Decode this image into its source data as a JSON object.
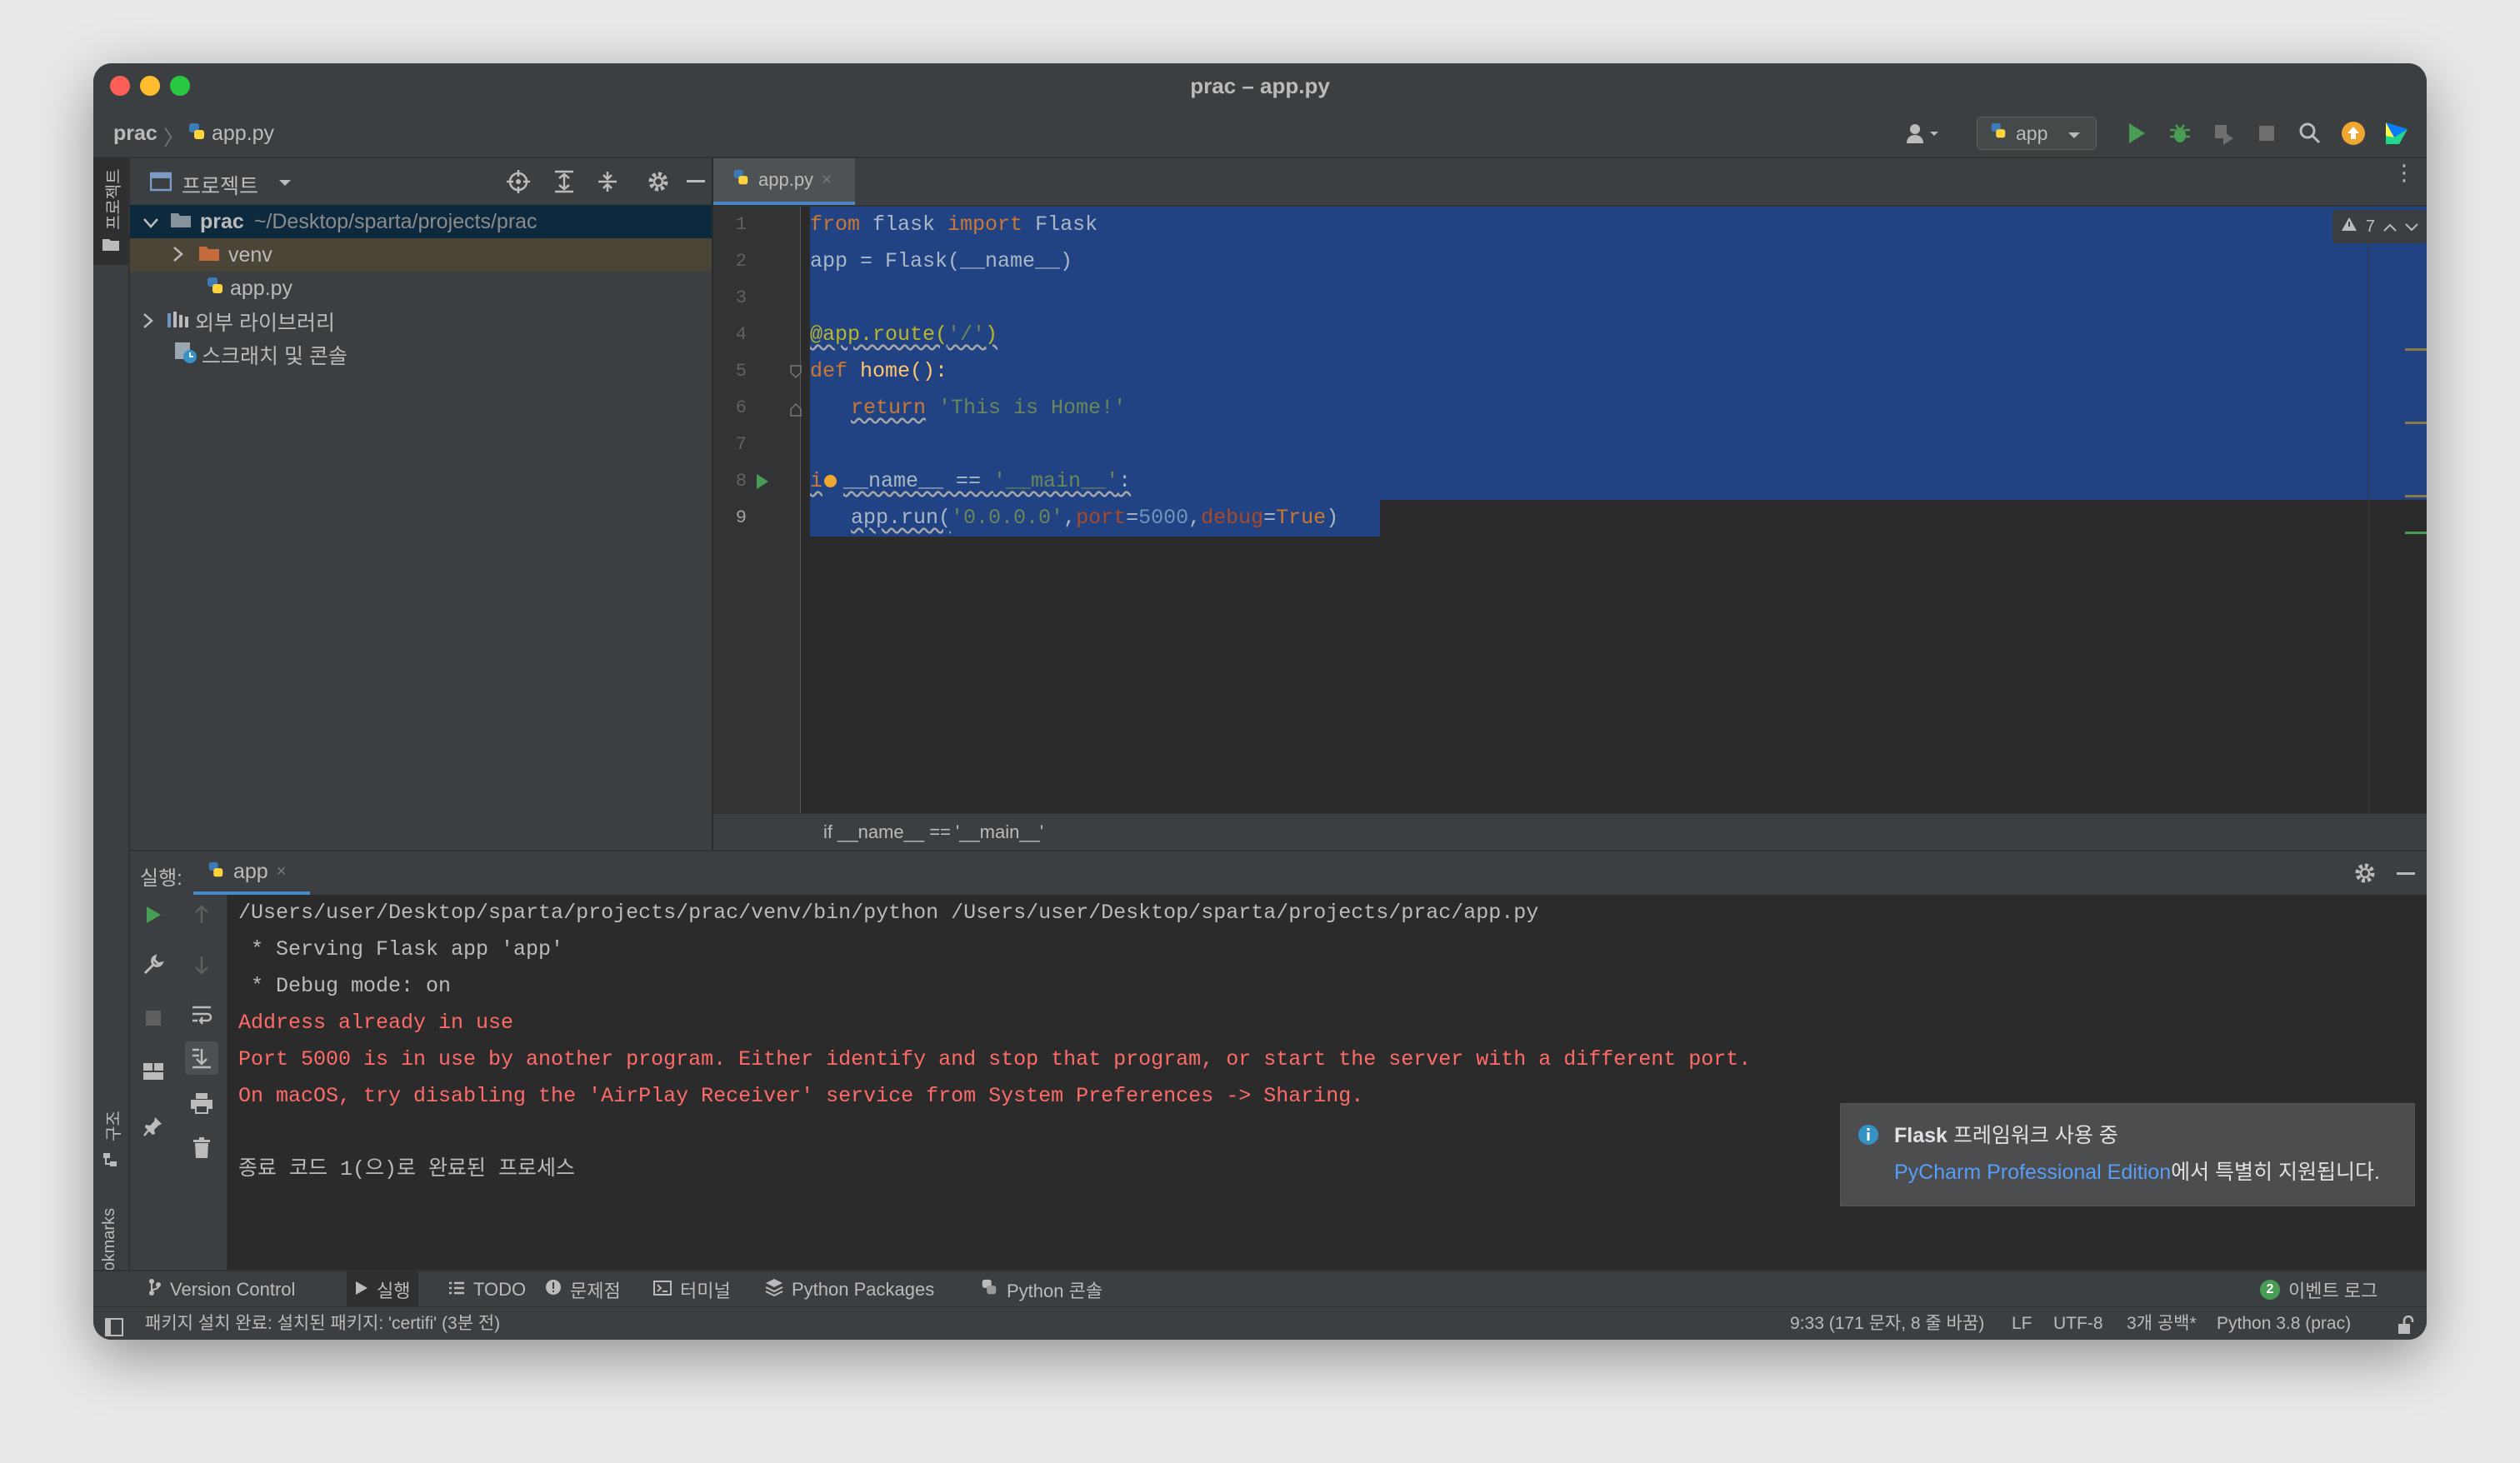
{
  "window": {
    "title": "prac – app.py"
  },
  "navbar": {
    "breadcrumb_project": "prac",
    "breadcrumb_file": "app.py",
    "run_config": "app"
  },
  "left_stripe": {
    "project_label": "프로젝트",
    "structure_label": "구조",
    "bookmarks_label": "Bookmarks"
  },
  "project_panel": {
    "title": "프로젝트",
    "tree": [
      {
        "name": "prac",
        "path": "~/Desktop/sparta/projects/prac"
      },
      {
        "name": "venv"
      },
      {
        "name": "app.py"
      },
      {
        "name": "외부 라이브러리"
      },
      {
        "name": "스크래치 및 콘솔"
      }
    ]
  },
  "editor": {
    "tab": "app.py",
    "warnings_count": "7",
    "line_numbers": [
      "1",
      "2",
      "3",
      "4",
      "5",
      "6",
      "7",
      "8",
      "9"
    ],
    "code": {
      "l1_from": "from",
      "l1_mod": " flask ",
      "l1_import": "import",
      "l1_name": " Flask",
      "l2": "app = Flask(__name__)",
      "l4_dec": "@app.route(",
      "l4_str": "'/'",
      "l4_end": ")",
      "l5_def": "def",
      "l5_rest": " home():",
      "l6_return": "return",
      "l6_str": "'This is Home!'",
      "l8_if": "i",
      "l8_rest": "__name__ == ",
      "l8_str": "'__main__'",
      "l8_end": ":",
      "l9_call": "app.run(",
      "l9_str": "'0.0.0.0'",
      "l9_comma": ",",
      "l9_port": "port",
      "l9_eq": "=",
      "l9_num": "5000",
      "l9_debug": "debug",
      "l9_true": "True",
      "l9_end": ")"
    },
    "breadcrumb": "if __name__ == '__main__'"
  },
  "run_panel": {
    "label": "실행:",
    "tab": "app",
    "output": [
      {
        "text": "/Users/user/Desktop/sparta/projects/prac/venv/bin/python /Users/user/Desktop/sparta/projects/prac/app.py",
        "error": false
      },
      {
        "text": " * Serving Flask app 'app'",
        "error": false
      },
      {
        "text": " * Debug mode: on",
        "error": false
      },
      {
        "text": "Address already in use",
        "error": true
      },
      {
        "text": "Port 5000 is in use by another program. Either identify and stop that program, or start the server with a different port.",
        "error": true
      },
      {
        "text": "On macOS, try disabling the 'AirPlay Receiver' service from System Preferences -> Sharing.",
        "error": true
      },
      {
        "text": "",
        "error": false
      },
      {
        "text": "종료 코드 1(으)로 완료된 프로세스",
        "error": false
      }
    ],
    "notification": {
      "title_bold": "Flask",
      "title_rest": " 프레임워크 사용 중",
      "link": "PyCharm Professional Edition",
      "rest": "에서 특별히 지원됩니다."
    }
  },
  "tool_strip": {
    "items": [
      "Version Control",
      "실행",
      "TODO",
      "문제점",
      "터미널",
      "Python Packages",
      "Python 콘솔"
    ],
    "event_log_count": "2",
    "event_log": "이벤트 로그"
  },
  "status_bar": {
    "message": "패키지 설치 완료: 설치된 패키지: 'certifi' (3분 전)",
    "position": "9:33 (171 문자, 8 줄 바꿈)",
    "line_sep": "LF",
    "encoding": "UTF-8",
    "indent": "3개 공백*",
    "interpreter": "Python 3.8 (prac)"
  },
  "colors": {
    "selection": "#214283",
    "error_text": "#ff6b68",
    "keyword": "#cc7832",
    "string": "#6a8759",
    "number": "#6897bb",
    "link": "#589df6"
  }
}
